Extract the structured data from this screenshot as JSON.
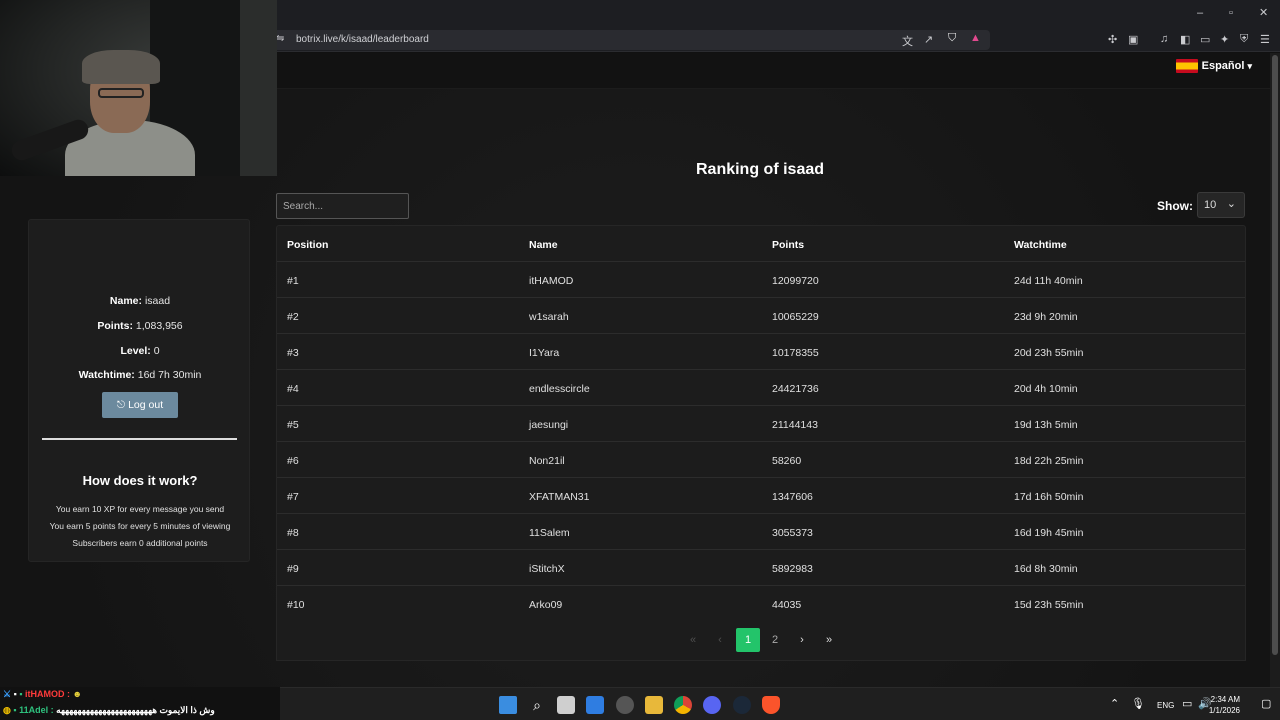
{
  "browser": {
    "url": "botrix.live/k/isaad/leaderboard",
    "window_controls": [
      "minimize",
      "maximize",
      "close"
    ]
  },
  "nav": {
    "flag_icon": "spain-flag-icon",
    "language": "Español"
  },
  "leaderboard": {
    "title": "Ranking of isaad",
    "search_placeholder": "Search...",
    "show_label": "Show:",
    "show_value": "10",
    "columns": [
      "Position",
      "Name",
      "Points",
      "Watchtime"
    ],
    "rows": [
      {
        "position": "#1",
        "name": "itHAMOD",
        "points": "12099720",
        "watchtime": "24d 11h 40min"
      },
      {
        "position": "#2",
        "name": "w1sarah",
        "points": "10065229",
        "watchtime": "23d 9h 20min"
      },
      {
        "position": "#3",
        "name": "I1Yara",
        "points": "10178355",
        "watchtime": "20d 23h 55min"
      },
      {
        "position": "#4",
        "name": "endlesscircle",
        "points": "24421736",
        "watchtime": "20d 4h 10min"
      },
      {
        "position": "#5",
        "name": "jaesungi",
        "points": "21144143",
        "watchtime": "19d 13h 5min"
      },
      {
        "position": "#6",
        "name": "Non21il",
        "points": "58260",
        "watchtime": "18d 22h 25min"
      },
      {
        "position": "#7",
        "name": "XFATMAN31",
        "points": "1347606",
        "watchtime": "17d 16h 50min"
      },
      {
        "position": "#8",
        "name": "11Salem",
        "points": "3055373",
        "watchtime": "16d 19h 45min"
      },
      {
        "position": "#9",
        "name": "iStitchX",
        "points": "5892983",
        "watchtime": "16d 8h 30min"
      },
      {
        "position": "#10",
        "name": "Arko09",
        "points": "44035",
        "watchtime": "15d 23h 55min"
      }
    ],
    "pagination": {
      "first": "«",
      "prev": "‹",
      "pages": [
        "1",
        "2"
      ],
      "current": "1",
      "next": "›",
      "last": "»"
    }
  },
  "user": {
    "name_label": "Name:",
    "name": "isaad",
    "points_label": "Points:",
    "points": "1,083,956",
    "level_label": "Level:",
    "level": "0",
    "watchtime_label": "Watchtime:",
    "watchtime": "16d 7h 30min",
    "logout_label": "Log out"
  },
  "how": {
    "title": "How does it work?",
    "lines": [
      "You earn 10 XP for every message you send",
      "You earn 5 points for every 5 minutes of viewing",
      "Subscribers earn 0 additional points"
    ]
  },
  "chat_overlay": {
    "line1_user": "itHAMOD :",
    "line2_user": "11Adel :",
    "line2_text": "وش ذا الايموت هههههههههههههههههههههههه"
  },
  "taskbar": {
    "language": "ENG",
    "time": "2:34 AM",
    "date": "1/1/2026"
  },
  "colors": {
    "accent_green": "#23c46a",
    "logout_button": "#6c8a9e",
    "background": "#171717"
  }
}
